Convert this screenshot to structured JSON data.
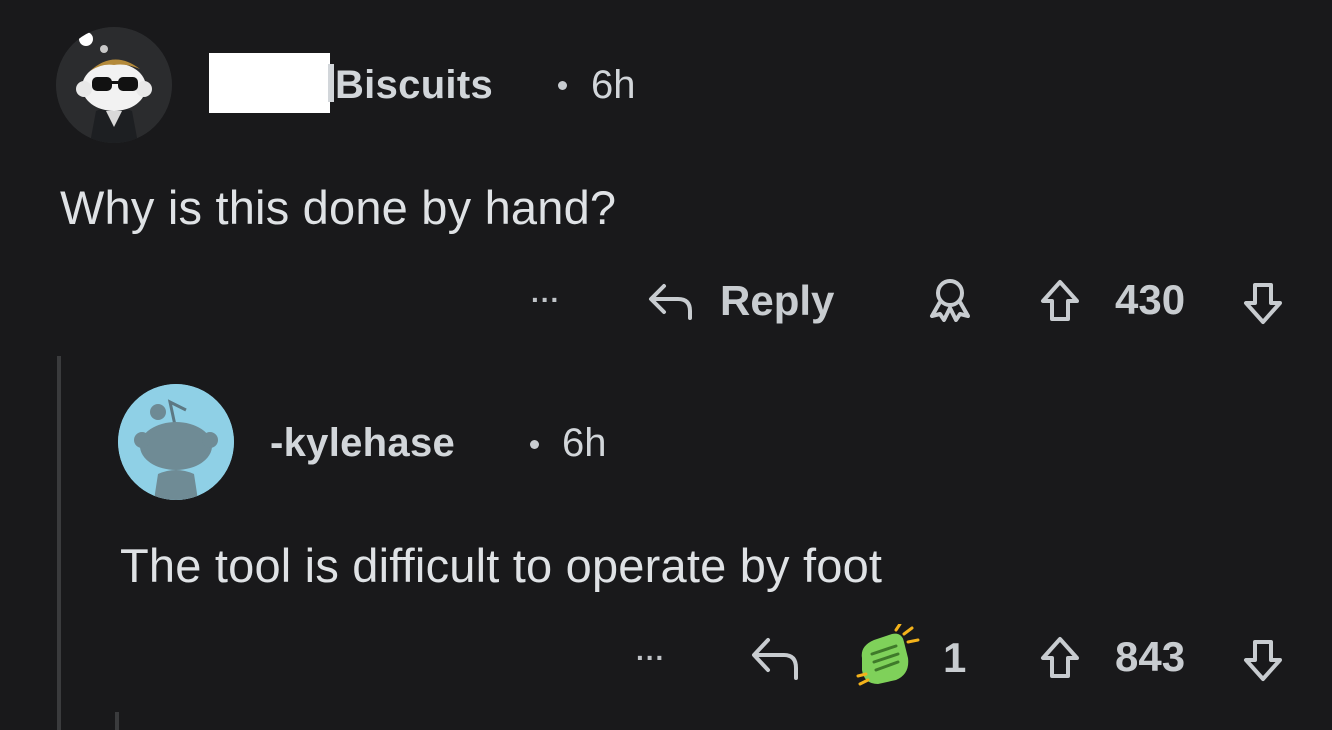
{
  "comment": {
    "username": "Biscuits",
    "time": "6h",
    "text": "Why is this done by hand?",
    "actions": {
      "more_label": "...",
      "reply_label": "Reply",
      "score": "430"
    }
  },
  "reply": {
    "username": "-kylehase",
    "time": "6h",
    "text": "The tool is difficult to operate by foot",
    "actions": {
      "more_label": "...",
      "award_count": "1",
      "score": "843"
    }
  },
  "colors": {
    "background": "#19191b",
    "text": "#d7dadc",
    "reply_avatar_bg": "#8fd0e6",
    "redaction": "#ffffff"
  }
}
